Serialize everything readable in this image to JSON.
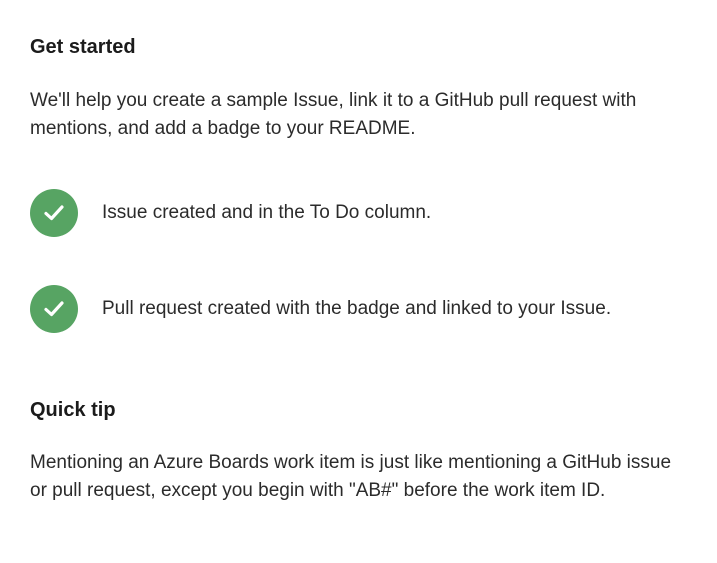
{
  "get_started": {
    "title": "Get started",
    "description": "We'll help you create a sample Issue, link it to a GitHub pull request with mentions, and add a badge to your README."
  },
  "steps": [
    {
      "label": "Issue created and in the To Do column.",
      "status": "complete",
      "icon": "checkmark-icon"
    },
    {
      "label": "Pull request created with the badge and linked to your Issue.",
      "status": "complete",
      "icon": "checkmark-icon"
    }
  ],
  "quick_tip": {
    "title": "Quick tip",
    "text": "Mentioning an Azure Boards work item is just like mentioning a GitHub issue or pull request, except you begin with \"AB#\" before the work item ID."
  },
  "colors": {
    "success": "#57a463",
    "text": "#2b2b2b",
    "heading": "#1b1b1b"
  }
}
